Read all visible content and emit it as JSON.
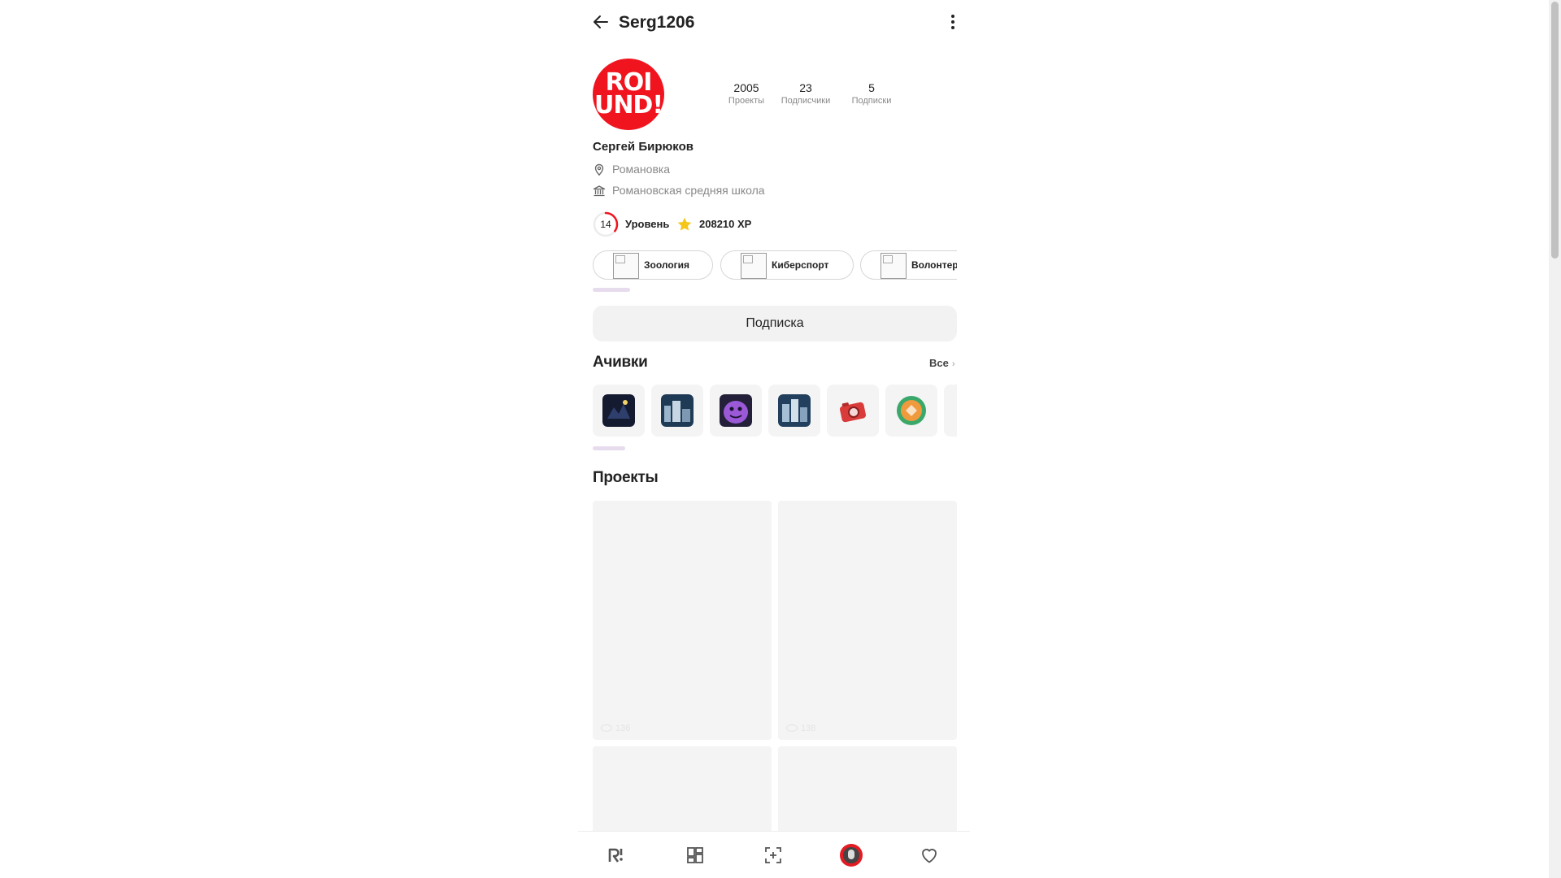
{
  "header": {
    "username": "Serg1206",
    "back_icon": "arrow-left-icon",
    "menu_icon": "more-vertical-icon"
  },
  "profile": {
    "avatar_logo_lines": [
      "ROI",
      "UND!"
    ],
    "full_name": "Сергей Бирюков",
    "location": "Романовка",
    "school": "Романовская средняя школа",
    "stats": [
      {
        "value": "2005",
        "label": "Проекты"
      },
      {
        "value": "23",
        "label": "Подписчики"
      },
      {
        "value": "5",
        "label": "Подписки"
      }
    ],
    "level": {
      "value": "14",
      "label": "Уровень",
      "progress": 0.35
    },
    "xp": "208210 XP"
  },
  "interests": [
    {
      "label": "Зоология"
    },
    {
      "label": "Киберспорт"
    },
    {
      "label": "Волонтерство"
    }
  ],
  "subscribe_label": "Подписка",
  "achievements": {
    "title": "Ачивки",
    "all_label": "Все",
    "items": [
      {
        "name": "achievement-dark-scene",
        "color": "#1f2a4a"
      },
      {
        "name": "achievement-city-scene",
        "color": "#3a5a78"
      },
      {
        "name": "achievement-purple-monster",
        "color": "#8a4fc8"
      },
      {
        "name": "achievement-city-scene-2",
        "color": "#3c5c7a"
      },
      {
        "name": "achievement-red-camera",
        "color": "#d93b3b"
      },
      {
        "name": "achievement-orange-badge",
        "color": "#e98a2b"
      },
      {
        "name": "achievement-partial",
        "color": "#f0c23a"
      }
    ]
  },
  "projects": {
    "title": "Проекты",
    "items": [
      {
        "views": "136"
      },
      {
        "views": "138"
      },
      {
        "views": ""
      },
      {
        "views": ""
      }
    ]
  },
  "colors": {
    "accent_red": "#f0141e",
    "star_yellow": "#f5c518",
    "chip_indicator": "#e7dcee"
  },
  "nav": [
    {
      "name": "nav-home",
      "icon": "round-logo-icon"
    },
    {
      "name": "nav-feed",
      "icon": "grid-icon"
    },
    {
      "name": "nav-create",
      "icon": "add-frame-icon"
    },
    {
      "name": "nav-profile",
      "icon": "avatar-icon"
    },
    {
      "name": "nav-favorites",
      "icon": "heart-icon"
    }
  ]
}
